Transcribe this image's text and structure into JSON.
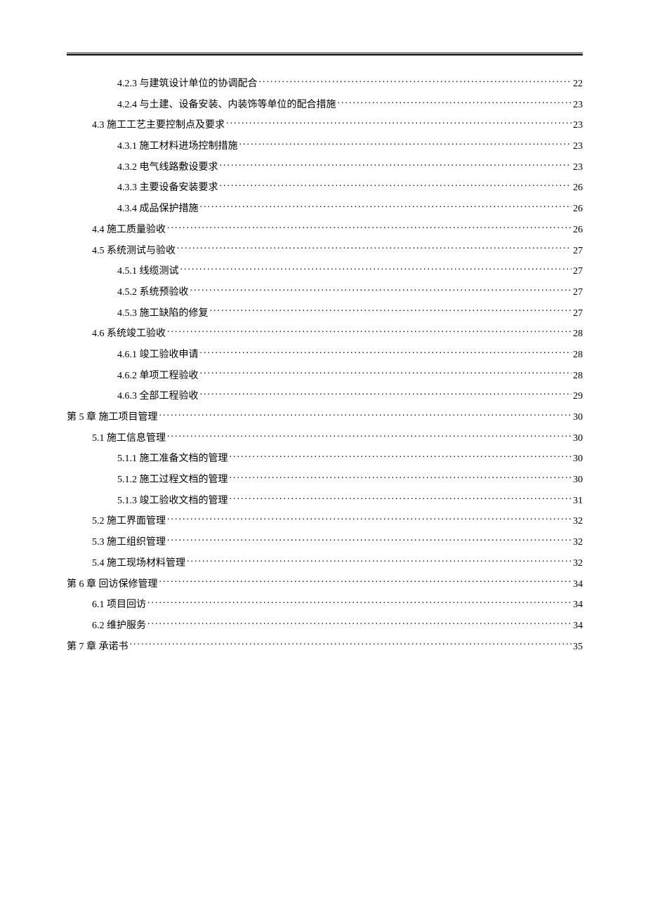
{
  "toc": [
    {
      "level": 2,
      "label": "4.2.3  与建筑设计单位的协调配合 ",
      "page": "22"
    },
    {
      "level": 2,
      "label": "4.2.4  与土建、设备安装、内装饰等单位的配合措施 ",
      "page": "23"
    },
    {
      "level": 1,
      "label": "4.3  施工工艺主要控制点及要求 ",
      "page": "23"
    },
    {
      "level": 2,
      "label": "4.3.1  施工材料进场控制措施 ",
      "page": "23"
    },
    {
      "level": 2,
      "label": "4.3.2  电气线路敷设要求 ",
      "page": "23"
    },
    {
      "level": 2,
      "label": "4.3.3  主要设备安装要求 ",
      "page": "26"
    },
    {
      "level": 2,
      "label": "4.3.4  成品保护措施 ",
      "page": "26"
    },
    {
      "level": 1,
      "label": "4.4  施工质量验收 ",
      "page": "26"
    },
    {
      "level": 1,
      "label": "4.5  系统测试与验收 ",
      "page": "27"
    },
    {
      "level": 2,
      "label": "4.5.1  线缆测试 ",
      "page": "27"
    },
    {
      "level": 2,
      "label": "4.5.2  系统预验收 ",
      "page": "27"
    },
    {
      "level": 2,
      "label": "4.5.3  施工缺陷的修复 ",
      "page": "27"
    },
    {
      "level": 1,
      "label": "4.6  系统竣工验收 ",
      "page": "28"
    },
    {
      "level": 2,
      "label": "4.6.1  竣工验收申请 ",
      "page": "28"
    },
    {
      "level": 2,
      "label": "4.6.2  单项工程验收 ",
      "page": "28"
    },
    {
      "level": 2,
      "label": "4.6.3  全部工程验收 ",
      "page": "29"
    },
    {
      "level": 0,
      "label": "第 5 章  施工项目管理 ",
      "page": "30"
    },
    {
      "level": 1,
      "label": "5.1  施工信息管理 ",
      "page": "30"
    },
    {
      "level": 2,
      "label": "5.1.1  施工准备文档的管理 ",
      "page": "30"
    },
    {
      "level": 2,
      "label": "5.1.2  施工过程文档的管理 ",
      "page": "30"
    },
    {
      "level": 2,
      "label": "5.1.3  竣工验收文档的管理 ",
      "page": "31"
    },
    {
      "level": 1,
      "label": "5.2  施工界面管理 ",
      "page": "32"
    },
    {
      "level": 1,
      "label": "5.3  施工组织管理 ",
      "page": "32"
    },
    {
      "level": 1,
      "label": "5.4  施工现场材料管理 ",
      "page": "32"
    },
    {
      "level": 0,
      "label": "第 6 章  回访保修管理 ",
      "page": "34"
    },
    {
      "level": 1,
      "label": "6.1  项目回访 ",
      "page": "34"
    },
    {
      "level": 1,
      "label": "6.2  维护服务 ",
      "page": "34"
    },
    {
      "level": 0,
      "label": "第 7 章  承诺书 ",
      "page": "35"
    }
  ]
}
